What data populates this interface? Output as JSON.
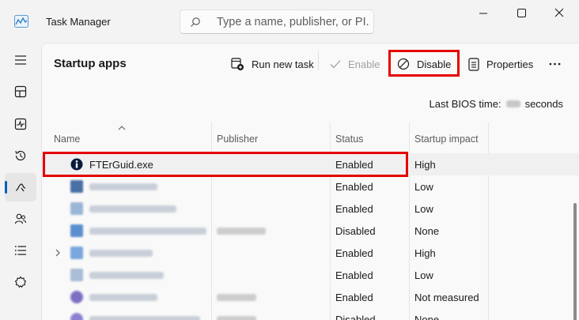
{
  "window": {
    "title": "Task Manager",
    "search_placeholder": "Type a name, publisher, or PI...",
    "controls": [
      "minimize",
      "maximize",
      "close"
    ]
  },
  "sidebar": {
    "items": [
      {
        "icon": "hamburger-icon",
        "active": false
      },
      {
        "icon": "processes-icon",
        "active": false
      },
      {
        "icon": "performance-icon",
        "active": false
      },
      {
        "icon": "app-history-icon",
        "active": false
      },
      {
        "icon": "startup-apps-icon",
        "active": true
      },
      {
        "icon": "users-icon",
        "active": false
      },
      {
        "icon": "details-icon",
        "active": false
      },
      {
        "icon": "services-icon",
        "active": false
      }
    ]
  },
  "page": {
    "title": "Startup apps",
    "toolbar": {
      "run_new_task": "Run new task",
      "enable": "Enable",
      "disable": "Disable",
      "properties": "Properties",
      "more": "…"
    },
    "bios_label": "Last BIOS time:",
    "bios_unit": "seconds"
  },
  "table": {
    "columns": [
      "Name",
      "Publisher",
      "Status",
      "Startup impact"
    ],
    "sort_column": "Name",
    "rows": [
      {
        "name": "FTErGuid.exe",
        "publisher": "",
        "status": "Enabled",
        "impact": "High",
        "selected": true,
        "expandable": false
      },
      {
        "name": "",
        "publisher": "",
        "status": "Enabled",
        "impact": "Low",
        "selected": false,
        "expandable": false
      },
      {
        "name": "",
        "publisher": "",
        "status": "Enabled",
        "impact": "Low",
        "selected": false,
        "expandable": false
      },
      {
        "name": "",
        "publisher": "",
        "status": "Disabled",
        "impact": "None",
        "selected": false,
        "expandable": false
      },
      {
        "name": "",
        "publisher": "",
        "status": "Enabled",
        "impact": "High",
        "selected": false,
        "expandable": true
      },
      {
        "name": "",
        "publisher": "",
        "status": "Enabled",
        "impact": "Low",
        "selected": false,
        "expandable": false
      },
      {
        "name": "",
        "publisher": "",
        "status": "Enabled",
        "impact": "Not measured",
        "selected": false,
        "expandable": false
      },
      {
        "name": "",
        "publisher": "",
        "status": "Disabled",
        "impact": "None",
        "selected": false,
        "expandable": false
      }
    ]
  },
  "colors": {
    "accent": "#005fb8",
    "highlight": "#e60000"
  }
}
